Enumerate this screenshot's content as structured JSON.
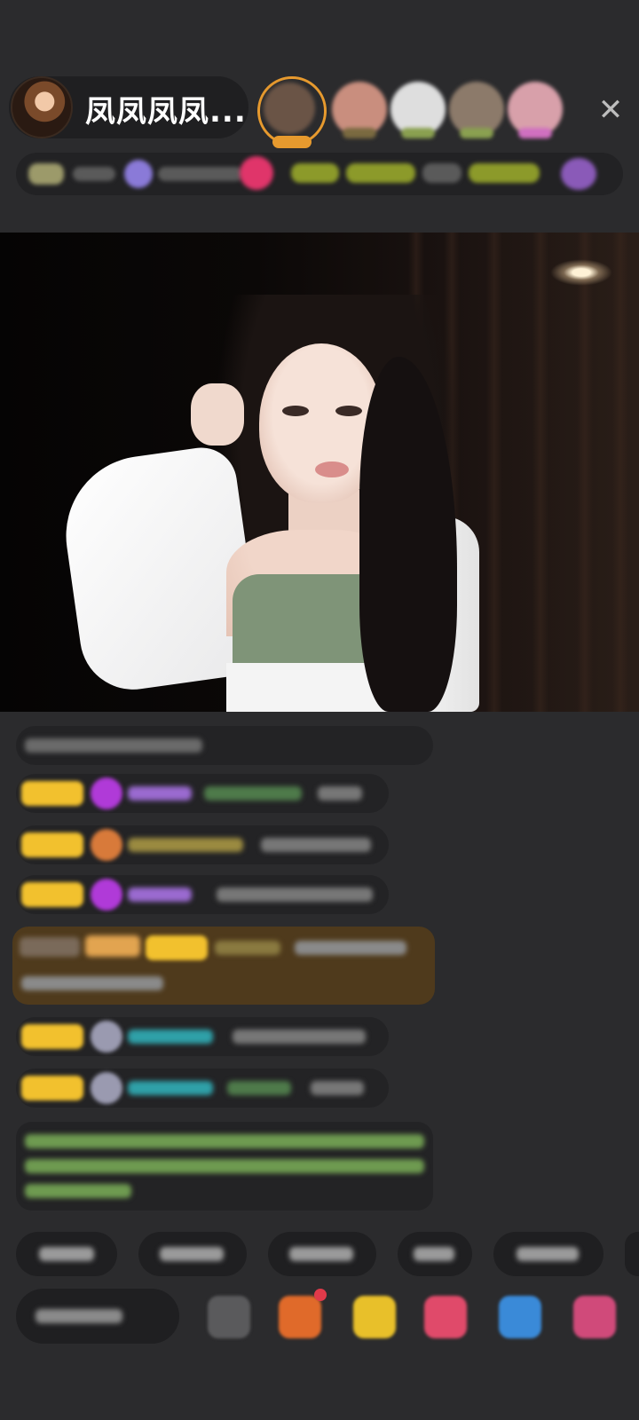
{
  "header": {
    "host_name": "凤凤凤凤...",
    "close_icon": "✕"
  },
  "colors": {
    "background": "#2b2b2d",
    "pill": "#1f1f21",
    "badge_gold": "#f2c12e",
    "highlight_green": "#86b85f",
    "teal_name": "#2fa0a8",
    "purple_name": "#b07ad8"
  }
}
